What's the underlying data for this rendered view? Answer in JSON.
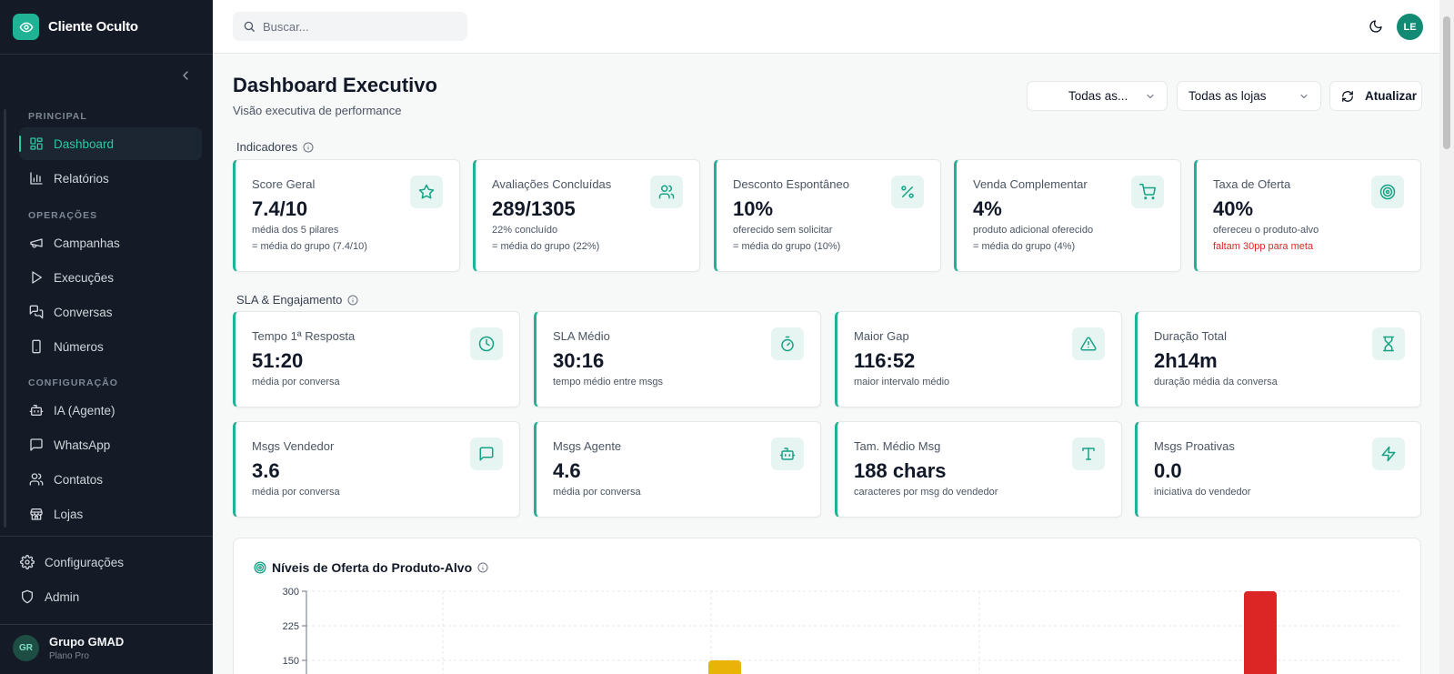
{
  "app": {
    "name": "Cliente Oculto"
  },
  "sidebar": {
    "sections": [
      {
        "label": "PRINCIPAL"
      },
      {
        "label": "OPERAÇÕES"
      },
      {
        "label": "CONFIGURAÇÃO"
      }
    ],
    "items": [
      {
        "label": "Dashboard",
        "icon": "dashboard-icon",
        "active": true
      },
      {
        "label": "Relatórios",
        "icon": "bar-chart-icon"
      },
      {
        "label": "Campanhas",
        "icon": "megaphone-icon"
      },
      {
        "label": "Execuções",
        "icon": "play-icon"
      },
      {
        "label": "Conversas",
        "icon": "chat-icon"
      },
      {
        "label": "Números",
        "icon": "phone-icon"
      },
      {
        "label": "IA (Agente)",
        "icon": "bot-icon"
      },
      {
        "label": "WhatsApp",
        "icon": "message-icon"
      },
      {
        "label": "Contatos",
        "icon": "users-icon"
      },
      {
        "label": "Lojas",
        "icon": "store-icon"
      }
    ],
    "bottom": [
      {
        "label": "Configurações",
        "icon": "gear-icon"
      },
      {
        "label": "Admin",
        "icon": "shield-icon"
      }
    ],
    "org": {
      "initials": "GR",
      "name": "Grupo GMAD",
      "plan": "Plano Pro"
    }
  },
  "topbar": {
    "search_placeholder": "Buscar...",
    "user_initials": "LE"
  },
  "header": {
    "title": "Dashboard Executivo",
    "subtitle": "Visão executiva de performance",
    "filter1": "Todas as...",
    "filter2": "Todas as lojas",
    "refresh_label": "Atualizar"
  },
  "indicators": {
    "title": "Indicadores",
    "cards": [
      {
        "label": "Score Geral",
        "value": "7.4/10",
        "sub": "média dos 5 pilares",
        "sub2": "= média do grupo (7.4/10)",
        "icon": "star-icon"
      },
      {
        "label": "Avaliações Concluídas",
        "value": "289/1305",
        "sub": "22% concluído",
        "sub2": "= média do grupo (22%)",
        "icon": "users-icon"
      },
      {
        "label": "Desconto Espontâneo",
        "value": "10%",
        "sub": "oferecido sem solicitar",
        "sub2": "= média do grupo (10%)",
        "icon": "percent-icon"
      },
      {
        "label": "Venda Complementar",
        "value": "4%",
        "sub": "produto adicional oferecido",
        "sub2": "= média do grupo (4%)",
        "icon": "cart-icon"
      },
      {
        "label": "Taxa de Oferta",
        "value": "40%",
        "sub": "ofereceu o produto-alvo",
        "sub2": "faltam 30pp para meta",
        "icon": "target-icon"
      }
    ]
  },
  "sla": {
    "title": "SLA & Engajamento",
    "cards": [
      {
        "label": "Tempo 1ª Resposta",
        "value": "51:20",
        "sub": "média por conversa",
        "icon": "clock-icon"
      },
      {
        "label": "SLA Médio",
        "value": "30:16",
        "sub": "tempo médio entre msgs",
        "icon": "stopwatch-icon"
      },
      {
        "label": "Maior Gap",
        "value": "116:52",
        "sub": "maior intervalo médio",
        "icon": "warning-icon"
      },
      {
        "label": "Duração Total",
        "value": "2h14m",
        "sub": "duração média da conversa",
        "icon": "hourglass-icon"
      },
      {
        "label": "Msgs Vendedor",
        "value": "3.6",
        "sub": "média por conversa",
        "icon": "message-icon"
      },
      {
        "label": "Msgs Agente",
        "value": "4.6",
        "sub": "média por conversa",
        "icon": "bot-icon"
      },
      {
        "label": "Tam. Médio Msg",
        "value": "188 chars",
        "sub": "caracteres por msg do vendedor",
        "icon": "type-icon"
      },
      {
        "label": "Msgs Proativas",
        "value": "0.0",
        "sub": "iniciativa do vendedor",
        "icon": "zap-icon"
      }
    ]
  },
  "chart_data": {
    "type": "bar",
    "title": "Níveis de Oferta do Produto-Alvo",
    "yticks": [
      "300",
      "225",
      "150"
    ],
    "ylim": [
      0,
      300
    ],
    "grid": true,
    "bars": [
      {
        "value": 150,
        "color": "#eab308"
      },
      {
        "value": 300,
        "color": "#dc2626"
      }
    ]
  },
  "colors": {
    "accent": "#1fb295",
    "sidebar": "#141b26",
    "alert": "#dc2626"
  }
}
